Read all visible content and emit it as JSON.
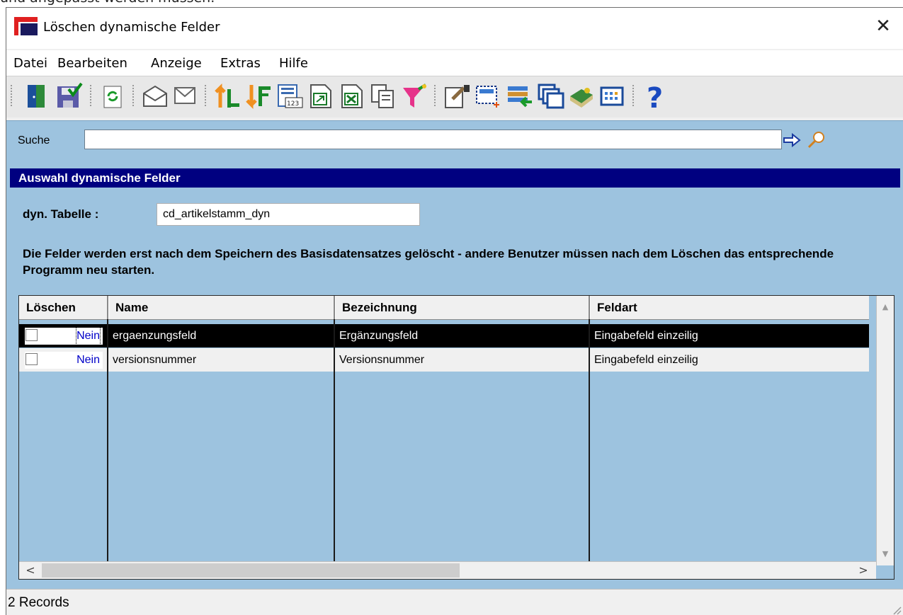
{
  "background_text": "und angepasst werden müssen.",
  "window": {
    "title": "Löschen dynamische Felder",
    "close_glyph": "✕"
  },
  "menu": [
    "Datei",
    "Bearbeiten",
    "Anzeige",
    "Extras",
    "Hilfe"
  ],
  "toolbar_icons": [
    "exit-door-icon",
    "save-icon",
    "refresh-icon",
    "mail-icon",
    "search-icon",
    "sort-ascending-icon",
    "sort-descending-icon",
    "number-format-icon",
    "export-icon",
    "excel-export-icon",
    "copy-icon",
    "filter-icon",
    "settings-icon",
    "select-add-icon",
    "import-icon",
    "windows-icon",
    "book-icon",
    "grid-icon",
    "help-icon"
  ],
  "search": {
    "label": "Suche",
    "value": ""
  },
  "section": {
    "title": "Auswahl dynamische Felder"
  },
  "dyn_table": {
    "label": "dyn. Tabelle :",
    "value": "cd_artikelstamm_dyn"
  },
  "notice": "Die Felder werden erst nach dem Speichern des Basisdatensatzes gelöscht - andere Benutzer müssen nach dem Löschen das entsprechende Programm neu starten.",
  "grid": {
    "columns": [
      "Löschen",
      "Name",
      "Bezeichnung",
      "Feldart"
    ],
    "rows": [
      {
        "loeschen": "Nein",
        "checked": false,
        "name": "ergaenzungsfeld",
        "bezeichnung": "Ergänzungsfeld",
        "feldart": "Eingabefeld einzeilig",
        "selected": true
      },
      {
        "loeschen": "Nein",
        "checked": false,
        "name": "versionsnummer",
        "bezeichnung": "Versionsnummer",
        "feldart": "Eingabefeld einzeilig",
        "selected": false
      }
    ]
  },
  "status": {
    "text": "2 Records"
  },
  "colors": {
    "section_header": "#000080",
    "panel": "#9dc3df",
    "link_blue": "#0000c8"
  }
}
